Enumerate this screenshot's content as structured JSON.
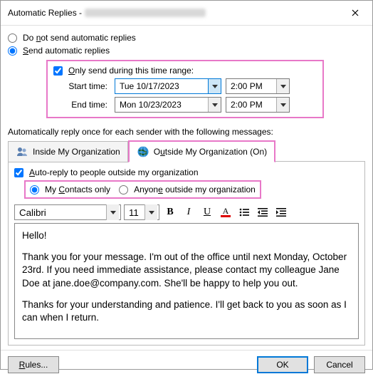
{
  "title": "Automatic Replies -",
  "radios": {
    "dont_send": "Do not send automatic replies",
    "send": "Send automatic replies"
  },
  "time_range": {
    "checkbox": "Only send during this time range:",
    "start_label": "Start time:",
    "end_label": "End time:",
    "start_date": "Tue 10/17/2023",
    "end_date": "Mon 10/23/2023",
    "start_time": "2:00 PM",
    "end_time": "2:00 PM"
  },
  "section_label": "Automatically reply once for each sender with the following messages:",
  "tabs": {
    "inside": "Inside My Organization",
    "outside": "Outside My Organization (On)"
  },
  "outside": {
    "auto_reply_check": "Auto-reply to people outside my organization",
    "contacts_only": "My Contacts only",
    "anyone": "Anyone outside my organization"
  },
  "toolbar": {
    "font": "Calibri",
    "size": "11",
    "bold": "B",
    "italic": "I",
    "underline": "U",
    "fontcolor": "A"
  },
  "message": {
    "p1": "Hello!",
    "p2": "Thank you for your message. I'm out of the office until next Monday, October 23rd. If you need immediate assistance, please contact my colleague Jane Doe at jane.doe@company.com. She'll be happy to help you out.",
    "p3": "Thanks for your understanding and patience. I'll get back to you as soon as I can when I return."
  },
  "footer": {
    "rules": "Rules...",
    "ok": "OK",
    "cancel": "Cancel"
  }
}
